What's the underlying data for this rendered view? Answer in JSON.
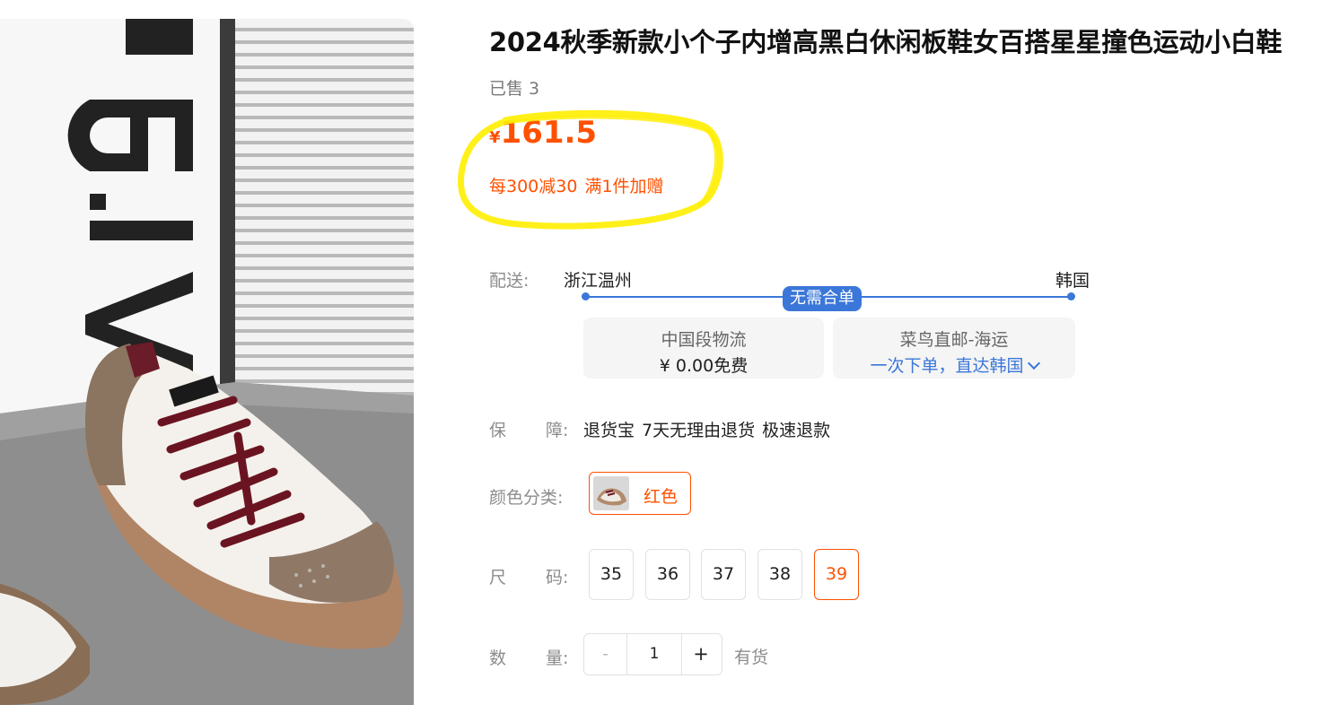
{
  "product": {
    "title": "2024秋季新款小个子内增高黑白休闲板鞋女百搭星星撞色运动小白鞋",
    "sold_label": "已售",
    "sold_count": "3",
    "price_currency": "¥",
    "price_amount": "161.5",
    "promo": [
      "每300减30",
      "满1件加赠"
    ]
  },
  "delivery": {
    "label": "配送:",
    "from": "浙江温州",
    "to": "韩国",
    "badge": "无需合单",
    "options": [
      {
        "line1": "中国段物流",
        "line2": "¥ 0.00免费"
      },
      {
        "line1": "菜鸟直邮-海运",
        "line2": "一次下单，直达韩国"
      }
    ]
  },
  "guarantee": {
    "label_a": "保",
    "label_b": "障:",
    "items": [
      "退货宝",
      "7天无理由退货",
      "极速退款"
    ]
  },
  "color": {
    "label": "颜色分类:",
    "selected": "红色"
  },
  "size": {
    "label_a": "尺",
    "label_b": "码:",
    "options": [
      "35",
      "36",
      "37",
      "38",
      "39"
    ],
    "selected": "39"
  },
  "quantity": {
    "label_a": "数",
    "label_b": "量:",
    "minus": "-",
    "value": "1",
    "plus": "+",
    "stock": "有货"
  },
  "colors": {
    "accent": "#ff5000",
    "link_blue": "#3b77d9",
    "highlight": "#ffee00"
  }
}
